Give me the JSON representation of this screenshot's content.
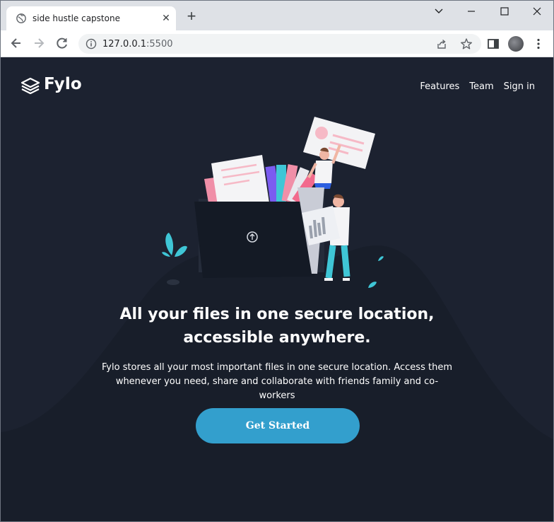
{
  "browser": {
    "tab_title": "side hustle capstone",
    "tab_close_glyph": "✕",
    "new_tab_glyph": "+",
    "url_host": "127.0.0.1",
    "url_port": ":5500"
  },
  "site": {
    "logo_text": "Fylo",
    "nav": [
      "Features",
      "Team",
      "Sign in"
    ],
    "headline_line1": "All your files in one secure location,",
    "headline_line2": "accessible anywhere.",
    "subtext_line1": "Fylo stores all your most important files in one secure location. Access them",
    "subtext_line2": "whenever you need, share and collaborate with friends family and co-workers",
    "cta_label": "Get Started"
  },
  "colors": {
    "page_bg": "#1c2230",
    "cta_bg": "#339fcd",
    "accent_cyan": "#3fc6d6",
    "accent_pink": "#f08fa8"
  }
}
